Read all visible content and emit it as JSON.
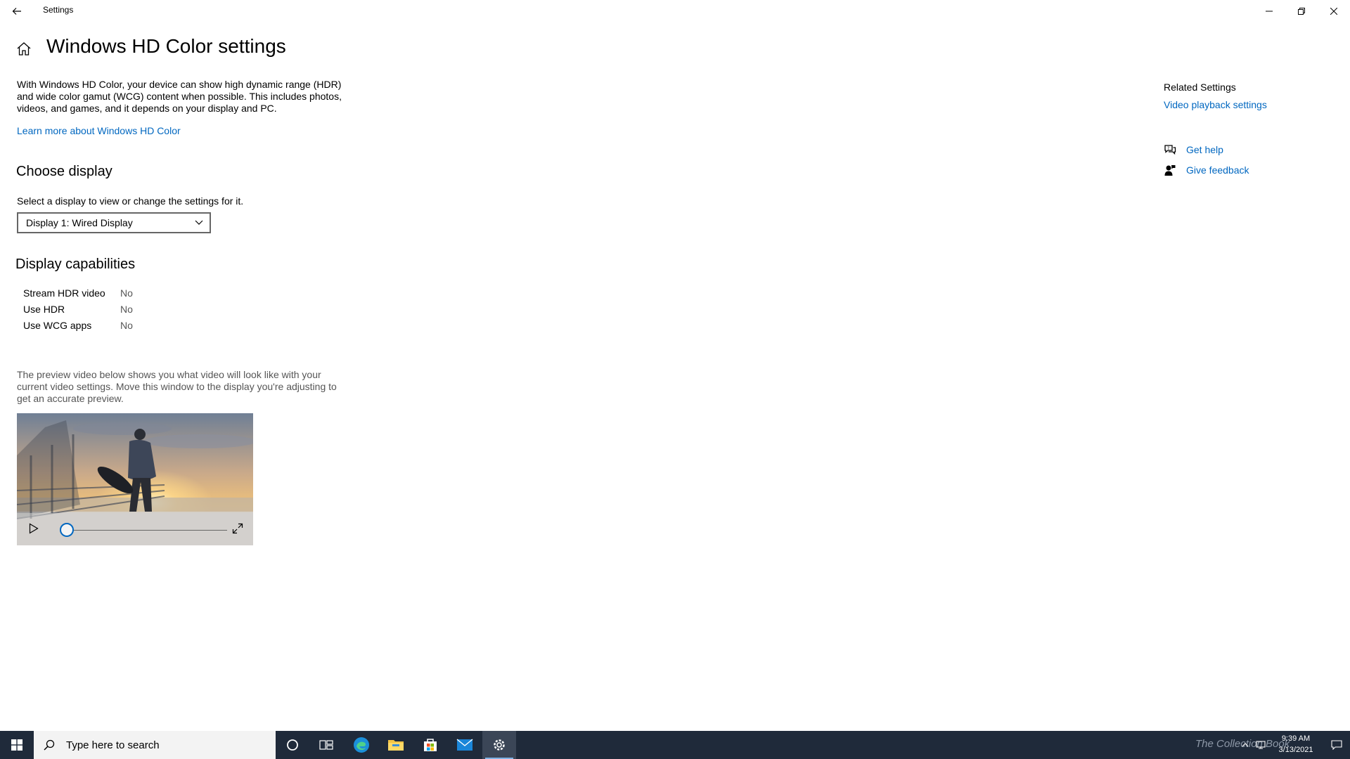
{
  "window": {
    "title": "Settings"
  },
  "page": {
    "title": "Windows HD Color settings",
    "intro": "With Windows HD Color, your device can show high dynamic range (HDR) and wide color gamut (WCG) content when possible. This includes photos, videos, and games, and it depends on your display and PC.",
    "learn_more_link": "Learn more about Windows HD Color"
  },
  "choose_display": {
    "heading": "Choose display",
    "label": "Select a display to view or change the settings for it.",
    "selected": "Display 1: Wired Display"
  },
  "capabilities": {
    "heading": "Display capabilities",
    "rows": [
      {
        "label": "Stream HDR video",
        "value": "No"
      },
      {
        "label": "Use HDR",
        "value": "No"
      },
      {
        "label": "Use WCG apps",
        "value": "No"
      }
    ]
  },
  "preview": {
    "text": "The preview video below shows you what video will look like with your current video settings. Move this window to the display you're adjusting to get an accurate preview.",
    "progress_fraction": 0
  },
  "related": {
    "heading": "Related Settings",
    "video_playback_link": "Video playback settings",
    "get_help": "Get help",
    "give_feedback": "Give feedback"
  },
  "taskbar": {
    "search_placeholder": "Type here to search",
    "watermark": "The Collection Book",
    "time": "9:39 AM",
    "date": "3/13/2021"
  },
  "colors": {
    "accent": "#0067c0",
    "taskbar": "#1f2a3a"
  },
  "icons": [
    "back-arrow-icon",
    "minimize-icon",
    "restore-icon",
    "close-icon",
    "home-icon",
    "chevron-down-icon",
    "play-icon",
    "fullscreen-icon",
    "chat-help-icon",
    "feedback-person-icon",
    "windows-logo-icon",
    "search-icon",
    "cortana-circle-icon",
    "task-view-icon",
    "edge-icon",
    "folder-icon",
    "store-bag-icon",
    "mail-icon",
    "gear-icon",
    "notification-icon"
  ]
}
